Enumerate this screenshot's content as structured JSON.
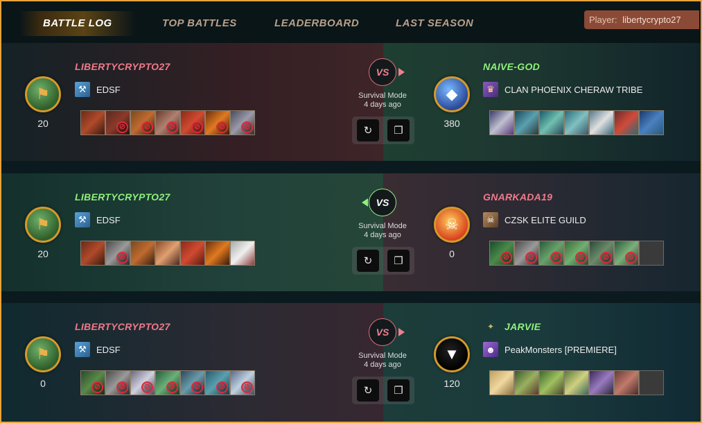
{
  "nav": {
    "tabs": [
      {
        "label": "BATTLE LOG",
        "active": true
      },
      {
        "label": "TOP BATTLES",
        "active": false
      },
      {
        "label": "LEADERBOARD",
        "active": false
      },
      {
        "label": "LAST SEASON",
        "active": false
      }
    ],
    "player_label": "Player:",
    "player_value": "libertycrypto27"
  },
  "battles": [
    {
      "left": {
        "name": "LIBERTYCRYPTO27",
        "result": "loss",
        "guild": "EDSF",
        "rating": "20"
      },
      "right": {
        "name": "NAIVE-GOD",
        "result": "win",
        "guild": "CLAN PHOENIX CHERAW TRIBE",
        "rating": "380"
      },
      "vs": "VS",
      "mode": "Survival Mode",
      "time": "4 days ago"
    },
    {
      "left": {
        "name": "LIBERTYCRYPTO27",
        "result": "win",
        "guild": "EDSF",
        "rating": "20"
      },
      "right": {
        "name": "GNARKADA19",
        "result": "loss",
        "guild": "CZSK ELITE GUILD",
        "rating": "0"
      },
      "vs": "VS",
      "mode": "Survival Mode",
      "time": "4 days ago"
    },
    {
      "left": {
        "name": "LIBERTYCRYPTO27",
        "result": "loss",
        "guild": "EDSF",
        "rating": "0"
      },
      "right": {
        "name": "JARVIE",
        "result": "win",
        "guild": "PeakMonsters [PREMIERE]",
        "rating": "120"
      },
      "vs": "VS",
      "mode": "Survival Mode",
      "time": "4 days ago"
    }
  ],
  "icons": {
    "replay": "replay-icon",
    "copy": "copy-icon",
    "dead": "dead-marker-icon"
  },
  "colors": {
    "accent": "#e8a33a",
    "loser_name": "#f07a8a",
    "winner_name": "#8ff07a",
    "player_chip": "#8a4a36"
  }
}
